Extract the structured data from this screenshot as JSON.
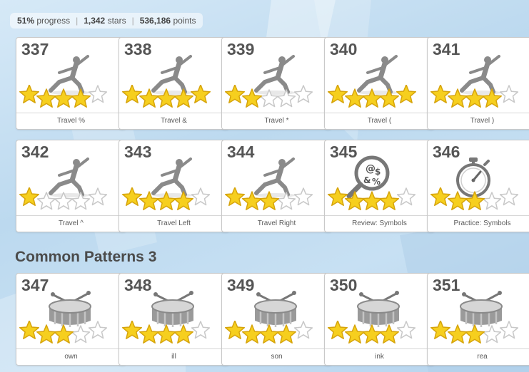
{
  "stats": {
    "progress_value": "51%",
    "progress_label": "progress",
    "stars_value": "1,342",
    "stars_label": "stars",
    "points_value": "536,186",
    "points_label": "points"
  },
  "section_title": "Common Patterns 3",
  "colors": {
    "star_fill": "#f6cf1e",
    "star_outline": "#d6a40c",
    "text_dark": "#555555",
    "accent_blue": "#bcd9ef"
  },
  "lessons": [
    {
      "number": "337",
      "caption": "Travel %",
      "icon": "figure-pose-icon",
      "stars": 4
    },
    {
      "number": "338",
      "caption": "Travel &",
      "icon": "figure-pose-icon",
      "stars": 5
    },
    {
      "number": "339",
      "caption": "Travel *",
      "icon": "figure-pose-icon",
      "stars": 2
    },
    {
      "number": "340",
      "caption": "Travel (",
      "icon": "figure-pose-icon",
      "stars": 5
    },
    {
      "number": "341",
      "caption": "Travel )",
      "icon": "figure-pose-icon",
      "stars": 4
    },
    {
      "number": "342",
      "caption": "Travel ^",
      "icon": "figure-pose-icon",
      "stars": 1
    },
    {
      "number": "343",
      "caption": "Travel Left",
      "icon": "figure-pose-icon",
      "stars": 4
    },
    {
      "number": "344",
      "caption": "Travel Right",
      "icon": "figure-pose-icon",
      "stars": 3
    },
    {
      "number": "345",
      "caption": "Review: Symbols",
      "icon": "magnifier-symbols-icon",
      "stars": 4
    },
    {
      "number": "346",
      "caption": "Practice: Symbols",
      "icon": "stopwatch-icon",
      "stars": 3
    },
    {
      "number": "347",
      "caption": "own",
      "icon": "drum-icon",
      "stars": 3
    },
    {
      "number": "348",
      "caption": "ill",
      "icon": "drum-icon",
      "stars": 4
    },
    {
      "number": "349",
      "caption": "son",
      "icon": "drum-icon",
      "stars": 4
    },
    {
      "number": "350",
      "caption": "ink",
      "icon": "drum-icon",
      "stars": 4
    },
    {
      "number": "351",
      "caption": "rea",
      "icon": "drum-icon",
      "stars": 3
    }
  ]
}
